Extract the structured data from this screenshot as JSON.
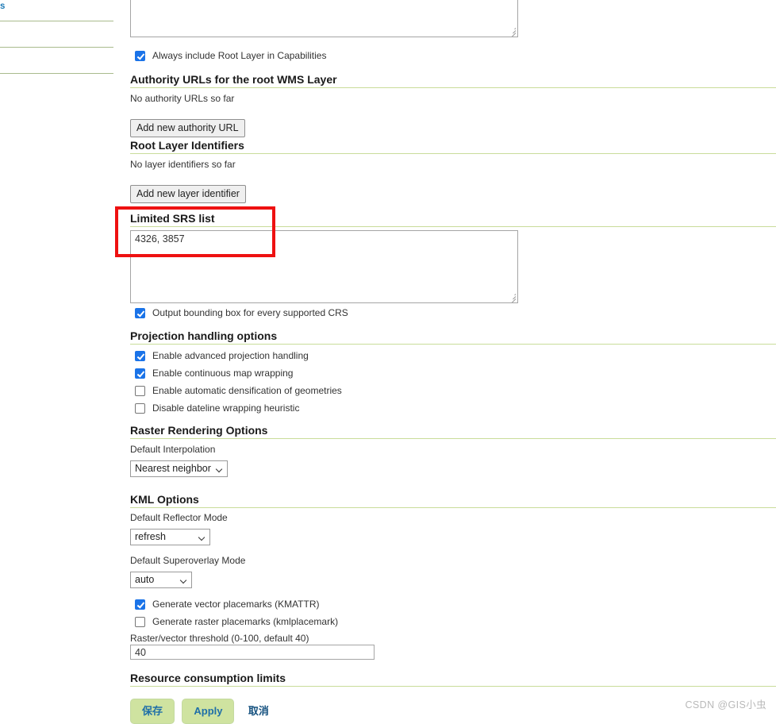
{
  "sidebar": {
    "truncated_link": "s"
  },
  "top_textarea": {
    "value": ""
  },
  "root_layer": {
    "always_include_label": "Always include Root Layer in Capabilities",
    "always_include_checked": true
  },
  "authority_urls": {
    "title": "Authority URLs for the root WMS Layer",
    "empty_text": "No authority URLs so far",
    "add_button": "Add new authority URL"
  },
  "root_layer_identifiers": {
    "title": "Root Layer Identifiers",
    "empty_text": "No layer identifiers so far",
    "add_button": "Add new layer identifier"
  },
  "limited_srs": {
    "title": "Limited SRS list",
    "value": "4326, 3857",
    "output_bbox_label": "Output bounding box for every supported CRS",
    "output_bbox_checked": true,
    "highlight_color": "#ee1111"
  },
  "projection_handling": {
    "title": "Projection handling options",
    "options": [
      {
        "label": "Enable advanced projection handling",
        "checked": true
      },
      {
        "label": "Enable continuous map wrapping",
        "checked": true
      },
      {
        "label": "Enable automatic densification of geometries",
        "checked": false
      },
      {
        "label": "Disable dateline wrapping heuristic",
        "checked": false
      }
    ]
  },
  "raster_rendering": {
    "title": "Raster Rendering Options",
    "interpolation_label": "Default Interpolation",
    "interpolation_value": "Nearest neighbor"
  },
  "kml_options": {
    "title": "KML Options",
    "reflector_label": "Default Reflector Mode",
    "reflector_value": "refresh",
    "superoverlay_label": "Default Superoverlay Mode",
    "superoverlay_value": "auto",
    "vector_placemarks_label": "Generate vector placemarks (KMATTR)",
    "vector_placemarks_checked": true,
    "raster_placemarks_label": "Generate raster placemarks (kmlplacemark)",
    "raster_placemarks_checked": false,
    "threshold_label": "Raster/vector threshold (0-100, default 40)",
    "threshold_value": "40"
  },
  "resource_limits": {
    "title": "Resource consumption limits"
  },
  "actions": {
    "save_label": "保存",
    "apply_label": "Apply",
    "cancel_label": "取消"
  },
  "watermark": {
    "text": "CSDN @GIS小虫"
  }
}
